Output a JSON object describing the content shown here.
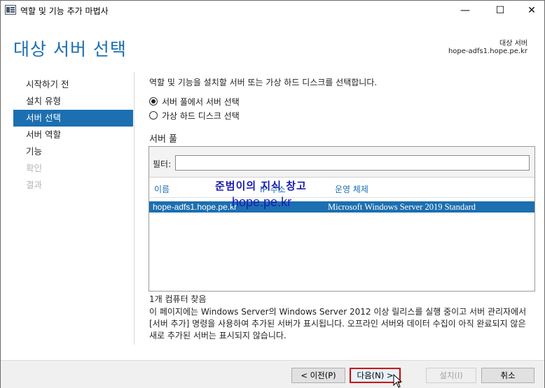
{
  "window": {
    "title": "역할 및 기능 추가 마법사",
    "min_glyph": "—",
    "max_glyph": "☐",
    "close_glyph": "✕"
  },
  "header": {
    "title": "대상 서버 선택",
    "destination_label": "대상 서버",
    "destination_value": "hope-adfs1.hope.pe.kr"
  },
  "nav": {
    "items": [
      {
        "label": "시작하기 전",
        "state": "normal"
      },
      {
        "label": "설치 유형",
        "state": "normal"
      },
      {
        "label": "서버 선택",
        "state": "active"
      },
      {
        "label": "서버 역할",
        "state": "normal"
      },
      {
        "label": "기능",
        "state": "normal"
      },
      {
        "label": "확인",
        "state": "disabled"
      },
      {
        "label": "결과",
        "state": "disabled"
      }
    ]
  },
  "content": {
    "instruction": "역할 및 기능을 설치할 서버 또는 가상 하드 디스크를 선택합니다.",
    "options": [
      {
        "label": "서버 풀에서 서버 선택",
        "checked": true
      },
      {
        "label": "가상 하드 디스크 선택",
        "checked": false
      }
    ],
    "pool_label": "서버 풀",
    "filter_label": "필터:",
    "filter_value": "",
    "columns": {
      "name": "이름",
      "ip": "IP 주소",
      "os": "운영 체제"
    },
    "rows": [
      {
        "name": "hope-adfs1.hope.pe.kr",
        "ip": "",
        "os": "Microsoft Windows Server 2019 Standard"
      }
    ],
    "found": "1개 컴퓨터 찾음",
    "description": "이 페이지에는 Windows Server의 Windows Server 2012 이상 릴리스를 실행 중이고 서버 관리자에서 [서버 추가] 명령을 사용하여 추가된 서버가 표시됩니다. 오프라인 서버와 데이터 수집이 아직 완료되지 않은 새로 추가된 서버는 표시되지 않습니다."
  },
  "watermark": {
    "line1": "준범이의 지식 창고",
    "line2": "hope.pe.kr"
  },
  "footer": {
    "prev": "< 이전(P)",
    "next": "다음(N) >",
    "install": "설치(I)",
    "cancel": "취소"
  },
  "colors": {
    "accent": "#1c6fb0",
    "highlight_border": "#d10000",
    "watermark": "#1a1ab4"
  }
}
